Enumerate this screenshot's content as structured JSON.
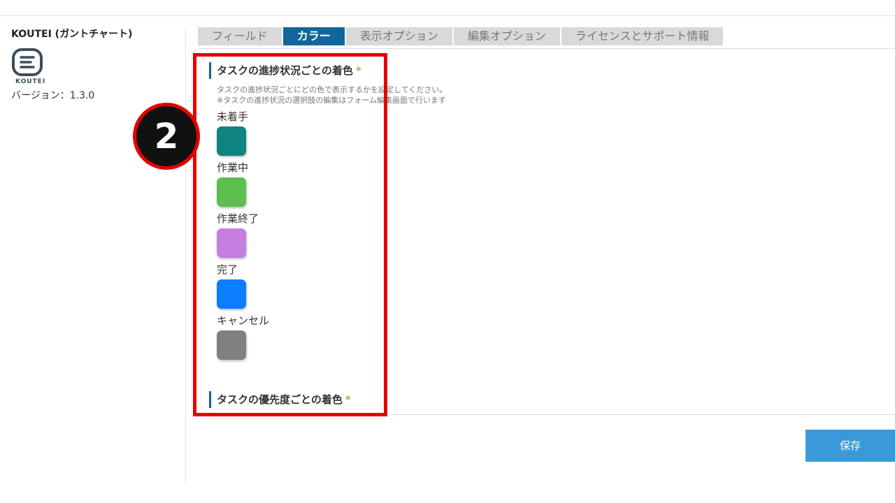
{
  "sidebar": {
    "app_name": "KOUTEI (ガントチャート)",
    "logo_text": "KOUTEI",
    "version": "バージョン：1.3.0"
  },
  "tabs": [
    {
      "label": "フィールド",
      "active": false
    },
    {
      "label": "カラー",
      "active": true
    },
    {
      "label": "表示オプション",
      "active": false
    },
    {
      "label": "編集オプション",
      "active": false
    },
    {
      "label": "ライセンスとサポート情報",
      "active": false
    }
  ],
  "status_section": {
    "heading": "タスクの進捗状況ごとの着色",
    "required_mark": "*",
    "desc_line1": "タスクの進捗状況ごとにどの色で表示するかを設定してください。",
    "desc_line2": "※タスクの進捗状況の選択肢の編集はフォーム編集画面で行います",
    "statuses": [
      {
        "label": "未着手",
        "color": "#0f8480"
      },
      {
        "label": "作業中",
        "color": "#5cbf4e"
      },
      {
        "label": "作業終了",
        "color": "#c37ee0"
      },
      {
        "label": "完了",
        "color": "#0a7efc"
      },
      {
        "label": "キャンセル",
        "color": "#808080"
      }
    ]
  },
  "priority_section": {
    "heading": "タスクの優先度ごとの着色",
    "required_mark": "*"
  },
  "save_label": "保存",
  "annotation": {
    "step_number": "2",
    "highlight_color": "#e60000"
  }
}
